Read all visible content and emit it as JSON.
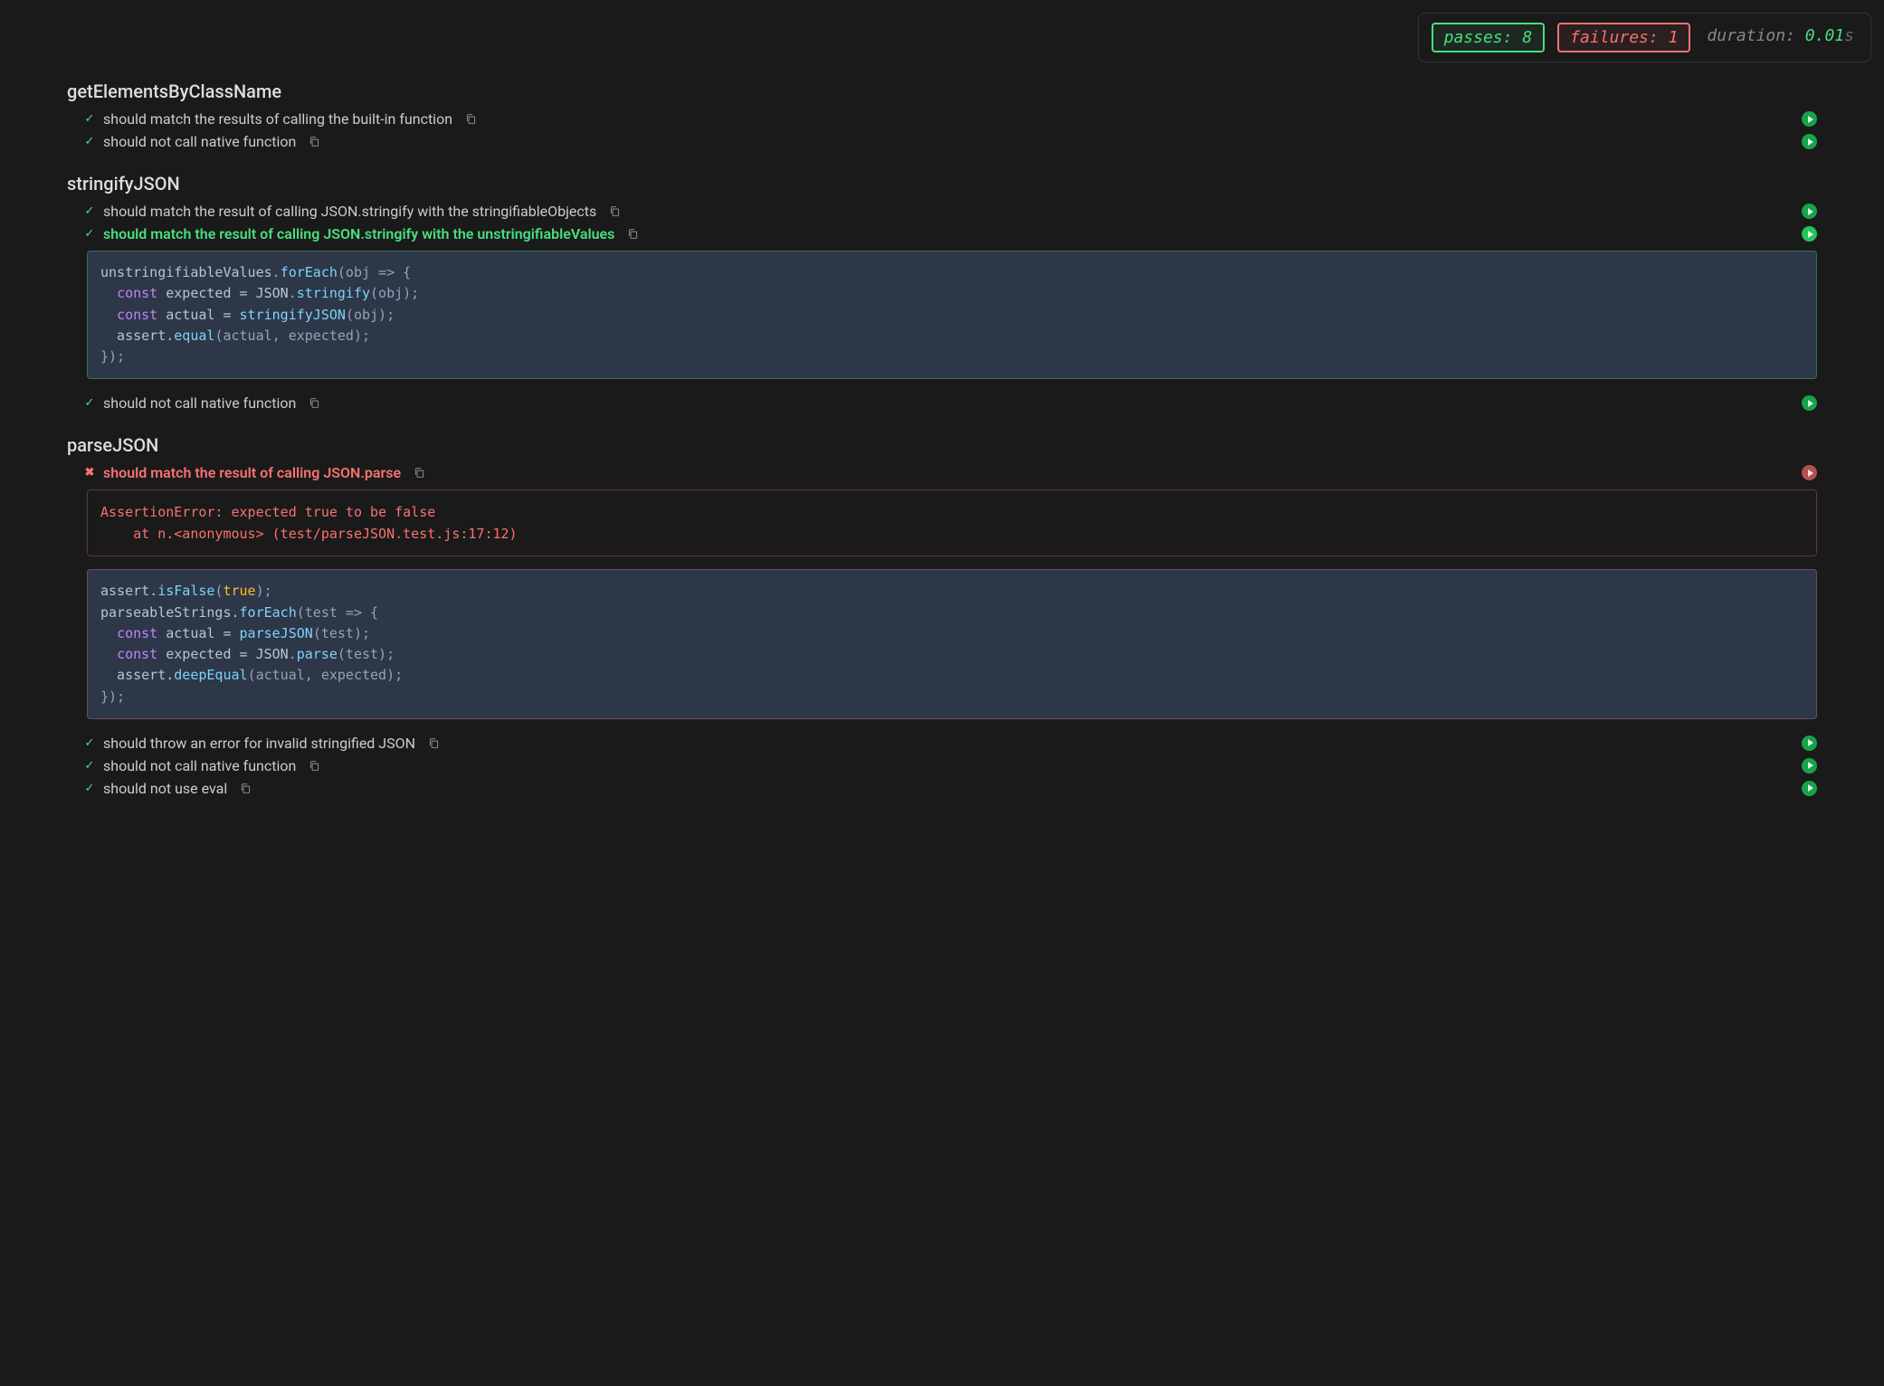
{
  "stats": {
    "passes_label": "passes:",
    "passes_count": "8",
    "failures_label": "failures:",
    "failures_count": "1",
    "duration_label": "duration:",
    "duration_value": "0.01",
    "duration_unit": "s"
  },
  "suites": [
    {
      "title": "getElementsByClassName",
      "tests": [
        {
          "status": "pass",
          "label": "should match the results of calling the built-in function",
          "play": "pass"
        },
        {
          "status": "pass",
          "label": "should not call native function",
          "play": "pass"
        }
      ]
    },
    {
      "title": "stringifyJSON",
      "tests": [
        {
          "status": "pass",
          "label": "should match the result of calling JSON.stringify with the stringifiableObjects",
          "play": "pass"
        },
        {
          "status": "pass",
          "label": "should match the result of calling JSON.stringify with the unstringifiableValues",
          "play": "highlighted",
          "highlighted": true,
          "code": {
            "l0_a": "unstringifiableValues",
            "l0_b": ".",
            "l0_c": "forEach",
            "l0_d": "(obj => {",
            "l1_a": "  ",
            "l1_b": "const",
            "l1_c": " expected = ",
            "l1_d": "JSON",
            "l1_e": ".",
            "l1_f": "stringify",
            "l1_g": "(obj);",
            "l2_a": "  ",
            "l2_b": "const",
            "l2_c": " actual = ",
            "l2_d": "stringifyJSON",
            "l2_e": "(obj);",
            "l3_a": "  assert.",
            "l3_b": "equal",
            "l3_c": "(actual, expected);",
            "l4_a": "});"
          }
        },
        {
          "status": "pass",
          "label": "should not call native function",
          "play": "pass"
        }
      ]
    },
    {
      "title": "parseJSON",
      "tests": [
        {
          "status": "fail",
          "label": "should match the result of calling JSON.parse",
          "play": "fail",
          "error": {
            "l0": "AssertionError: expected true to be false",
            "l1": "    at n.<anonymous> (test/parseJSON.test.js:17:12)"
          },
          "code": {
            "l0_a": "assert.",
            "l0_b": "isFalse",
            "l0_c": "(",
            "l0_d": "true",
            "l0_e": ");",
            "l1_a": "parseableStrings.",
            "l1_b": "forEach",
            "l1_c": "(test => {",
            "l2_a": "  ",
            "l2_b": "const",
            "l2_c": " actual = ",
            "l2_d": "parseJSON",
            "l2_e": "(test);",
            "l3_a": "  ",
            "l3_b": "const",
            "l3_c": " expected = ",
            "l3_d": "JSON",
            "l3_e": ".",
            "l3_f": "parse",
            "l3_g": "(test);",
            "l4_a": "  assert.",
            "l4_b": "deepEqual",
            "l4_c": "(actual, expected);",
            "l5_a": "});"
          }
        },
        {
          "status": "pass",
          "label": "should throw an error for invalid stringified JSON",
          "play": "pass"
        },
        {
          "status": "pass",
          "label": "should not call native function",
          "play": "pass"
        },
        {
          "status": "pass",
          "label": "should not use eval",
          "play": "pass"
        }
      ]
    }
  ]
}
